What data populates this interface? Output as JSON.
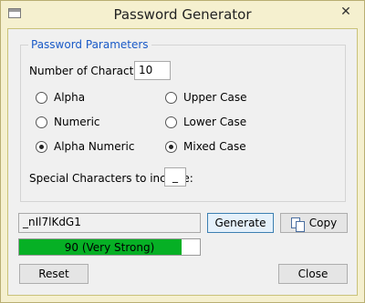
{
  "window": {
    "title": "Password Generator",
    "close_glyph": "✕",
    "app_icon": "window-icon"
  },
  "params": {
    "group_title": "Password Parameters",
    "num_chars_label": "Number of Characters:",
    "num_chars_value": "10",
    "options": {
      "alpha": {
        "label": "Alpha",
        "checked": false
      },
      "numeric": {
        "label": "Numeric",
        "checked": false
      },
      "alpha_numeric": {
        "label": "Alpha Numeric",
        "checked": true
      },
      "upper_case": {
        "label": "Upper Case",
        "checked": false
      },
      "lower_case": {
        "label": "Lower Case",
        "checked": false
      },
      "mixed_case": {
        "label": "Mixed Case",
        "checked": true
      }
    },
    "special_label": "Special Characters to include:",
    "special_value": "_"
  },
  "output": {
    "password": "_nIl7lKdG1",
    "generate_label": "Generate",
    "copy_label": "Copy",
    "copy_icon": "copy-icon",
    "strength_text": "90 (Very Strong)",
    "strength_percent": 90,
    "strength_color": "#06b025"
  },
  "footer": {
    "reset_label": "Reset",
    "close_label": "Close"
  }
}
